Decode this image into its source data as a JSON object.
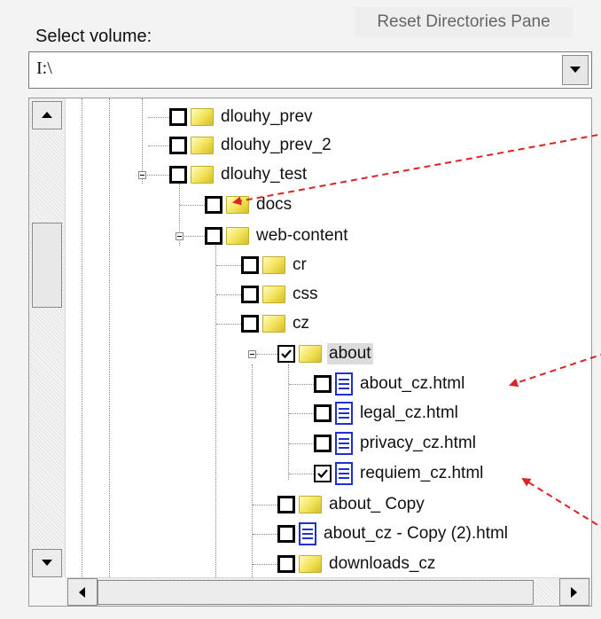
{
  "header": {
    "reset_label": "Reset Directories Pane"
  },
  "volume": {
    "label": "Select volume:",
    "value": "I:\\"
  },
  "tree": {
    "nodes": [
      {
        "label": "dlouhy_prev",
        "type": "folder",
        "checked": false,
        "expanded": false
      },
      {
        "label": "dlouhy_prev_2",
        "type": "folder",
        "checked": false,
        "expanded": false
      },
      {
        "label": "dlouhy_test",
        "type": "folder",
        "checked": false,
        "expanded": true
      },
      {
        "label": "docs",
        "type": "folder",
        "checked": false,
        "expanded": false
      },
      {
        "label": "web-content",
        "type": "folder",
        "checked": false,
        "expanded": true
      },
      {
        "label": "cr",
        "type": "folder",
        "checked": false,
        "expanded": false
      },
      {
        "label": "css",
        "type": "folder",
        "checked": false,
        "expanded": false
      },
      {
        "label": "cz",
        "type": "folder",
        "checked": false,
        "expanded": false
      },
      {
        "label": "about",
        "type": "folder",
        "checked": true,
        "expanded": true,
        "selected": true
      },
      {
        "label": "about_cz.html",
        "type": "file",
        "checked": false
      },
      {
        "label": "legal_cz.html",
        "type": "file",
        "checked": false
      },
      {
        "label": "privacy_cz.html",
        "type": "file",
        "checked": false
      },
      {
        "label": "requiem_cz.html",
        "type": "file",
        "checked": true
      },
      {
        "label": "about_ Copy",
        "type": "folder",
        "checked": false,
        "expanded": false
      },
      {
        "label": "about_cz - Copy (2).html",
        "type": "file",
        "checked": false
      },
      {
        "label": "downloads_cz",
        "type": "folder",
        "checked": false,
        "expanded": false
      }
    ]
  },
  "annotation_color": "#dd2222",
  "icons": {
    "dropdown": "chevron-down-icon",
    "scroll_up": "arrow-up-icon",
    "scroll_down": "arrow-down-icon",
    "scroll_left": "arrow-left-icon",
    "scroll_right": "arrow-right-icon"
  }
}
